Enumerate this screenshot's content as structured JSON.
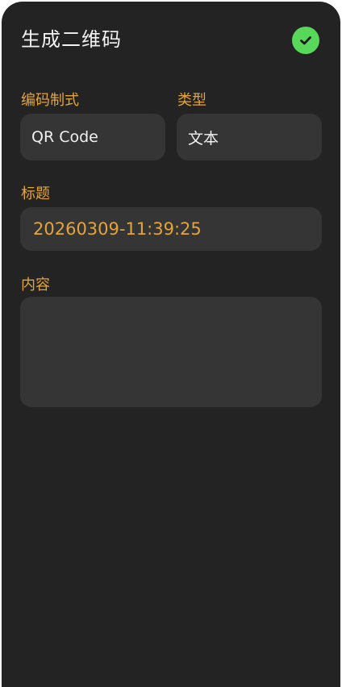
{
  "header": {
    "title": "生成二维码",
    "confirm_icon": "check-circle-icon",
    "confirm_color": "#58d85a"
  },
  "form": {
    "format_label": "编码制式",
    "format_value": "QR Code",
    "type_label": "类型",
    "type_value": "文本",
    "title_label": "标题",
    "title_value": "20260309-11:39:25",
    "content_label": "内容",
    "content_value": ""
  },
  "colors": {
    "background": "#232323",
    "field": "#353535",
    "accent": "#e3a43c"
  }
}
